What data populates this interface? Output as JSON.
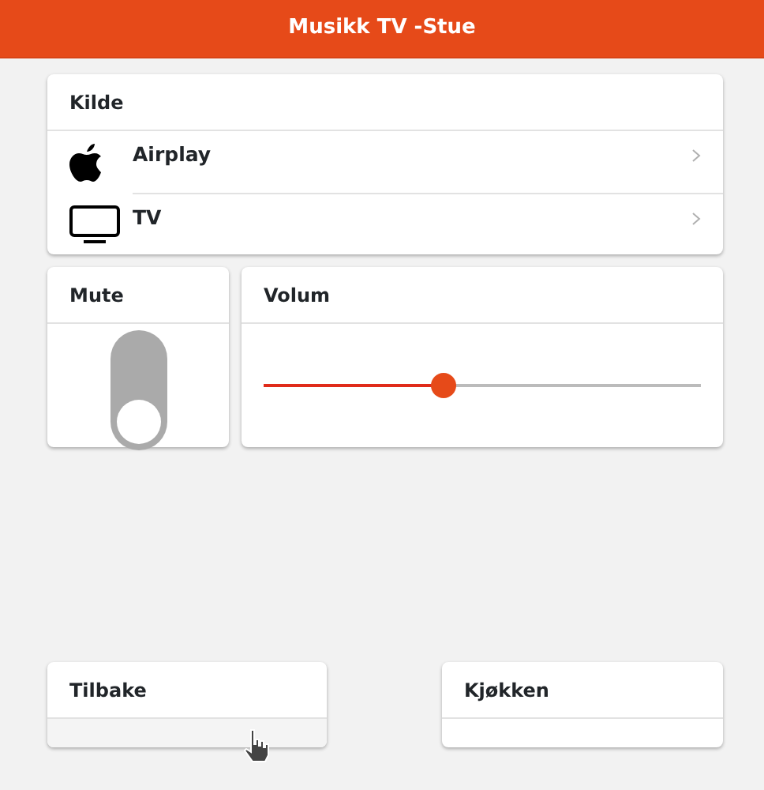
{
  "header": {
    "title": "Musikk TV -Stue"
  },
  "source_card": {
    "title": "Kilde",
    "items": [
      {
        "kind": "apple",
        "label": "Airplay"
      },
      {
        "kind": "tv",
        "label": "TV"
      }
    ]
  },
  "mute_card": {
    "title": "Mute",
    "on": false
  },
  "volume_card": {
    "title": "Volum",
    "level": 0.41
  },
  "nav_cards": [
    {
      "label": "Tilbake",
      "hovered": true
    },
    {
      "label": "Kjøkken",
      "hovered": false
    }
  ]
}
